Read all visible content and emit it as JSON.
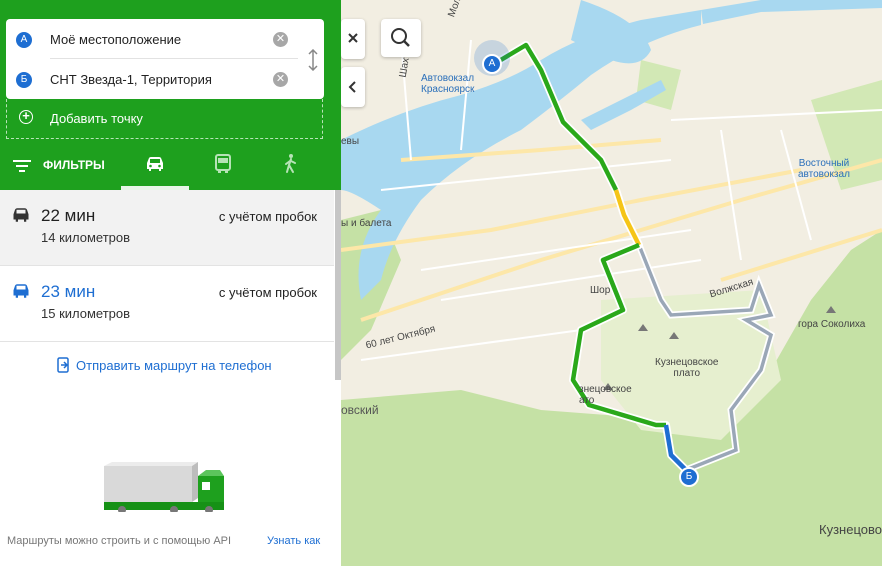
{
  "waypoints": [
    {
      "badge": "A",
      "text": "Моё местоположение"
    },
    {
      "badge": "Б",
      "text": "СНТ Звезда-1, Территория"
    }
  ],
  "add_point": "Добавить точку",
  "filters_label": "ФИЛЬТРЫ",
  "routes": [
    {
      "time": "22 мин",
      "traffic": "с учётом пробок",
      "distance": "14 километров"
    },
    {
      "time": "23 мин",
      "traffic": "с учётом пробок",
      "distance": "15 километров"
    }
  ],
  "send_to_phone": "Отправить маршрут на телефон",
  "api_note": "Маршруты можно строить и с помощью API",
  "learn_more": "Узнать как",
  "map": {
    "labels": {
      "avtovokzal": "Автовокзал\nКрасноярск",
      "vostochny": "Восточный\nавтовокзал",
      "volzhskaya": "Волжская",
      "sokoliha": "гора Соколиха",
      "kuznetsovskoe_plato": "Кузнецовское\nплато",
      "kuznetsovskoe_partial": "знецовское\nато",
      "oktyabrya": "60 лет Октября",
      "shor": "Шор",
      "baleta": "ы и балета",
      "ovsky": "овский",
      "evy": "евы",
      "shakh": "Шахт",
      "mol": "Мол",
      "kuznetsovo": "Кузнецово"
    },
    "marker_a": "А",
    "marker_b": "Б"
  },
  "colors": {
    "header_green": "#1ea01e",
    "link_blue": "#1e6ed2",
    "river": "#a8d8f0",
    "forest": "#c5e1a5",
    "route_green": "#2aa81a",
    "route_yellow": "#f5c518"
  },
  "icons": [
    "close-icon",
    "swap-icon",
    "plus-circle-icon",
    "filter-icon",
    "car-icon",
    "bus-icon",
    "pedestrian-icon",
    "phone-send-icon",
    "search-icon",
    "chevron-left-icon"
  ]
}
